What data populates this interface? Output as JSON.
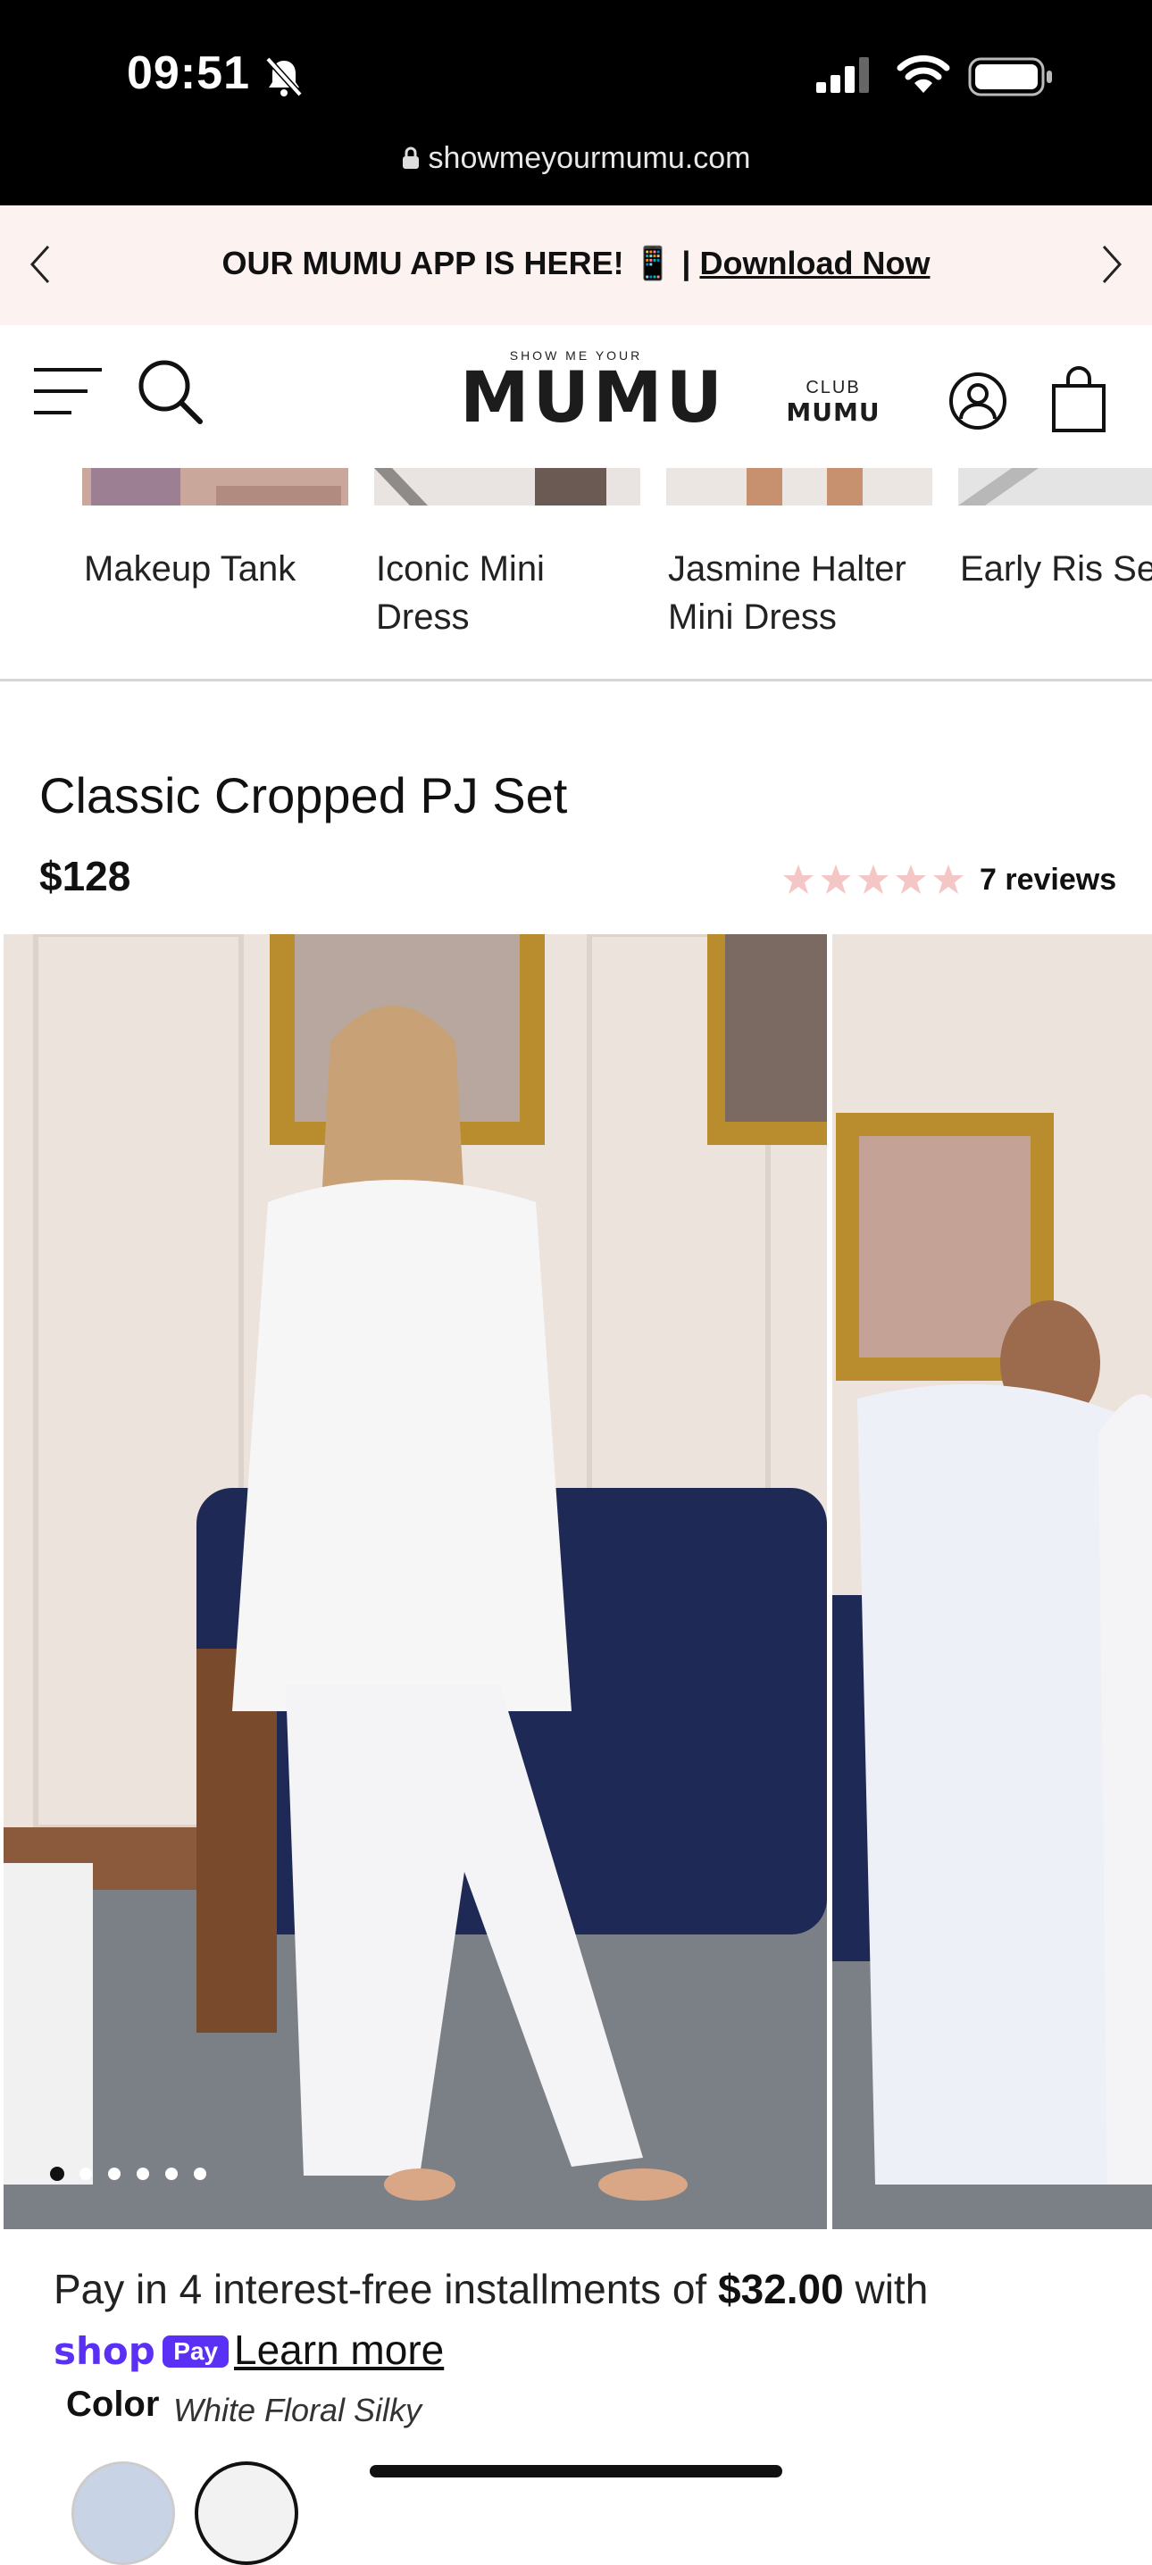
{
  "status_bar": {
    "time": "09:51",
    "url": "showmeyourmumu.com"
  },
  "announcement": {
    "text": "OUR MUMU APP IS HERE! 📱 | ",
    "link": "Download Now"
  },
  "header": {
    "logo_small": "SHOW ME YOUR",
    "logo_big": "MUMU",
    "club_line1": "CLUB",
    "club_line2": "MUMU"
  },
  "related_products": [
    {
      "label": "Makeup Tank"
    },
    {
      "label": "Iconic Mini Dress"
    },
    {
      "label": "Jasmine Halter Mini Dress"
    },
    {
      "label": "Early Ris Set"
    }
  ],
  "product": {
    "title": "Classic Cropped PJ Set",
    "price": "$128",
    "rating": 5,
    "reviews": "7 reviews",
    "gallery_images": 6,
    "gallery_active_index": 0
  },
  "installments": {
    "prefix": "Pay in 4 interest-free installments of ",
    "amount": "$32.00",
    "suffix": " with",
    "shop_brand": "shop",
    "pay_badge": "Pay",
    "learn_more": "Learn more"
  },
  "color": {
    "label": "Color",
    "value": "White Floral Silky"
  },
  "colors": {
    "accent_purple": "#5a31f4",
    "announce_bg": "#fcf3f1",
    "star_pink": "#f5c6c6"
  }
}
